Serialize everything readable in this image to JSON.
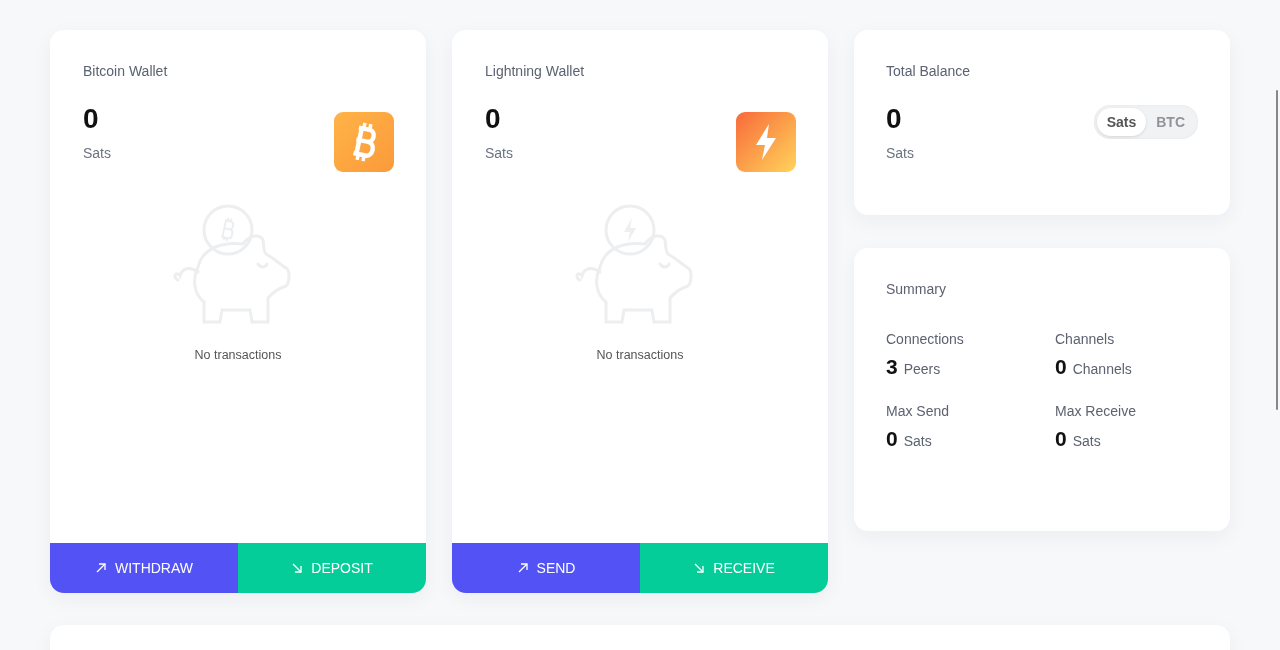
{
  "wallets": [
    {
      "title": "Bitcoin Wallet",
      "kind": "bitcoin",
      "amount": "0",
      "unit": "Sats",
      "empty_text": "No transactions",
      "actions": [
        {
          "label": "WITHDRAW",
          "kind": "out"
        },
        {
          "label": "DEPOSIT",
          "kind": "in"
        }
      ]
    },
    {
      "title": "Lightning Wallet",
      "kind": "lightning",
      "amount": "0",
      "unit": "Sats",
      "empty_text": "No transactions",
      "actions": [
        {
          "label": "SEND",
          "kind": "out"
        },
        {
          "label": "RECEIVE",
          "kind": "in"
        }
      ]
    }
  ],
  "total_balance": {
    "title": "Total Balance",
    "amount": "0",
    "unit": "Sats",
    "units": [
      {
        "label": "Sats",
        "selected": true
      },
      {
        "label": "BTC",
        "selected": false
      }
    ]
  },
  "summary": {
    "title": "Summary",
    "stats": [
      {
        "label": "Connections",
        "value": "3",
        "unit": "Peers"
      },
      {
        "label": "Channels",
        "value": "0",
        "unit": "Channels"
      },
      {
        "label": "Max Send",
        "value": "0",
        "unit": "Sats"
      },
      {
        "label": "Max Receive",
        "value": "0",
        "unit": "Sats"
      }
    ]
  }
}
